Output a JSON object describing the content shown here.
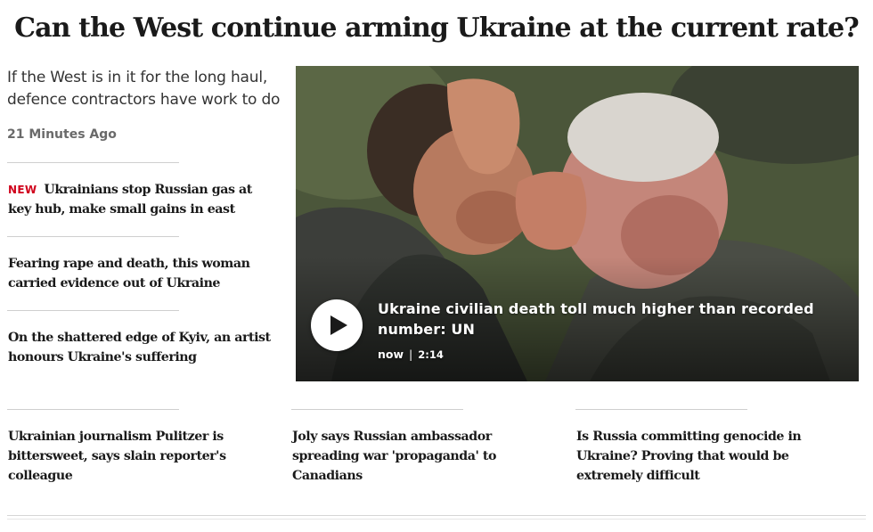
{
  "headline": "Can the West continue arming Ukraine at the current rate?",
  "deck": "If the West is in it for the long haul, defence contractors have work to do",
  "time_ago": "21 Minutes Ago",
  "side_stories": [
    {
      "tag": "NEW",
      "title": "Ukrainians stop Russian gas at key hub, make small gains in east"
    },
    {
      "tag": "",
      "title": "Fearing rape and death, this woman carried evidence out of Ukraine"
    },
    {
      "tag": "",
      "title": "On the shattered edge of Kyiv, an artist honours Ukraine's suffering"
    }
  ],
  "video": {
    "title": "Ukraine civilian death toll much higher than recorded number: UN",
    "posted": "now",
    "separator": "|",
    "duration": "2:14",
    "play_icon": "play-icon"
  },
  "bottom_stories": [
    {
      "title": "Ukrainian journalism Pulitzer is bittersweet, says slain reporter's colleague"
    },
    {
      "title": "Joly says Russian ambassador spreading war 'propaganda' to Canadians"
    },
    {
      "title": "Is Russia committing genocide in Ukraine? Proving that would be extremely difficult"
    }
  ],
  "colors": {
    "accent_new": "#d0021b",
    "text": "#1a1a1a",
    "muted": "#6a6a6a",
    "rule": "#cfcfcf"
  }
}
